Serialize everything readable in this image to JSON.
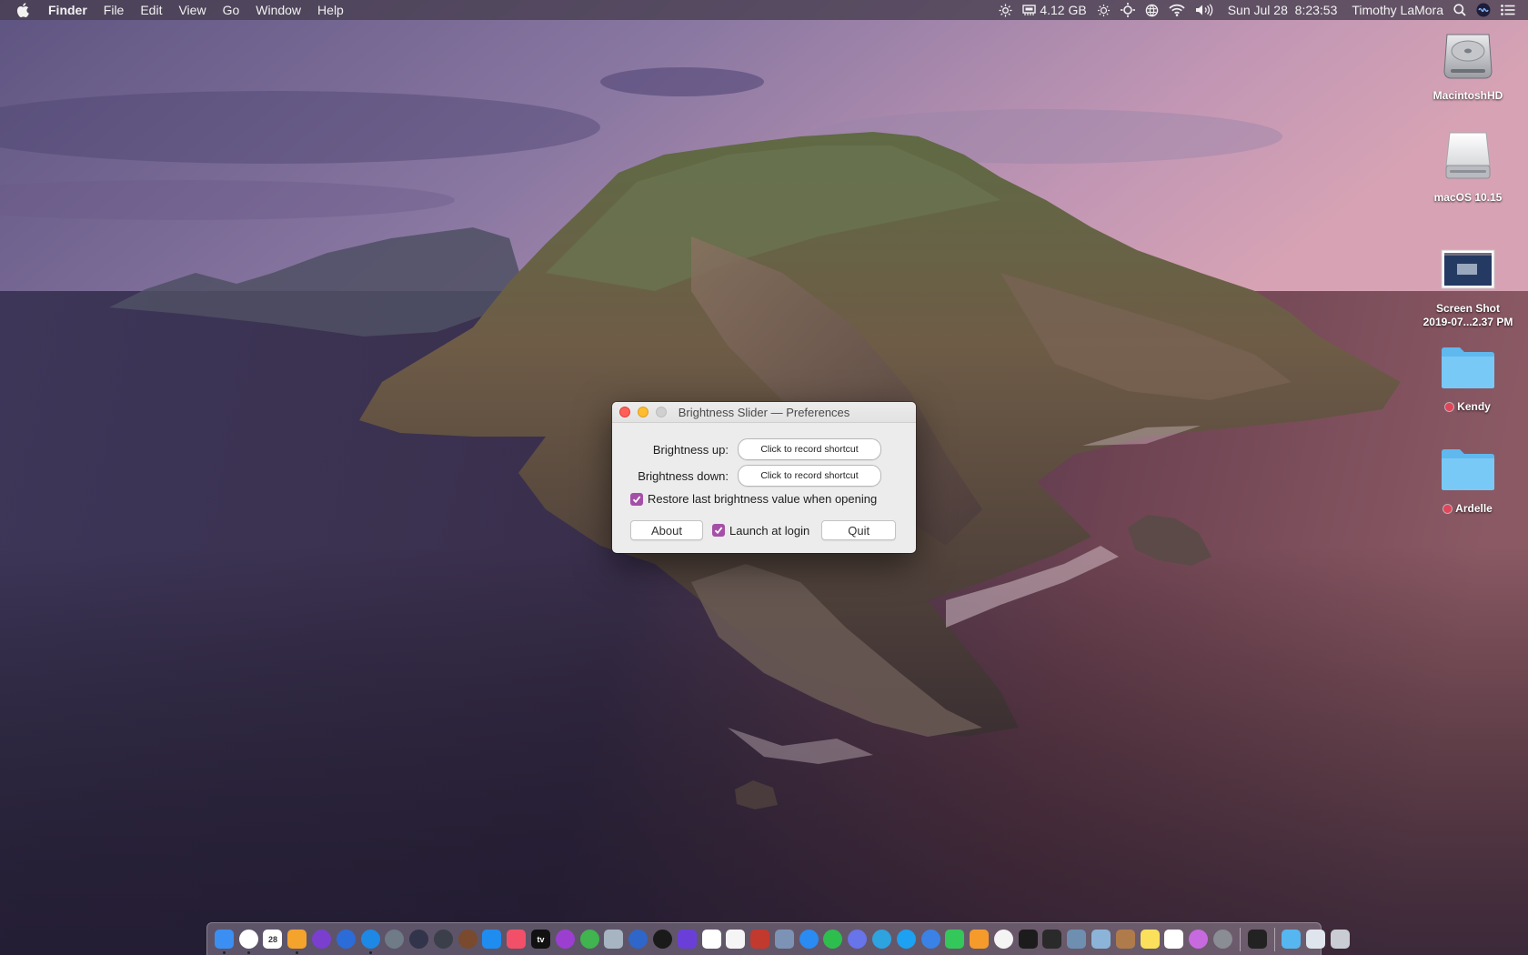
{
  "menubar": {
    "app_name": "Finder",
    "menus": [
      "File",
      "Edit",
      "View",
      "Go",
      "Window",
      "Help"
    ],
    "memory": "4.12 GB",
    "datetime": "Sun Jul 28  8:23:53",
    "user": "Timothy LaMora"
  },
  "desktop": {
    "icons": [
      {
        "label": "MacintoshHD",
        "kind": "hard-drive-icon"
      },
      {
        "label": "macOS 10.15",
        "kind": "external-drive-icon"
      },
      {
        "label": "Screen Shot\n2019-07...2.37 PM",
        "line1": "Screen Shot",
        "line2": "2019-07...2.37 PM",
        "kind": "screenshot-file-icon"
      },
      {
        "label": "Kendy",
        "kind": "folder-icon",
        "tag_color": "#e0455a"
      },
      {
        "label": "Ardelle",
        "kind": "folder-icon",
        "tag_color": "#e0455a"
      }
    ]
  },
  "prefs_window": {
    "title": "Brightness Slider — Preferences",
    "brightness_up_label": "Brightness up:",
    "brightness_down_label": "Brightness down:",
    "shortcut_placeholder": "Click to record shortcut",
    "restore_label": "Restore last brightness value when opening",
    "restore_checked": true,
    "about_label": "About",
    "launch_label": "Launch at login",
    "launch_checked": true,
    "quit_label": "Quit"
  },
  "dock": {
    "apps": [
      {
        "name": "finder-icon",
        "color": "#3b8ff2"
      },
      {
        "name": "launcher-icon",
        "color": "#ffffff"
      },
      {
        "name": "calendar-icon",
        "color": "#ffffff",
        "text": "28"
      },
      {
        "name": "flower-app-icon",
        "color": "#f4a32c"
      },
      {
        "name": "compass-app-icon",
        "color": "#7a3fcf"
      },
      {
        "name": "system-app-icon",
        "color": "#2c6cd8"
      },
      {
        "name": "safari-icon",
        "color": "#1e88e5"
      },
      {
        "name": "rocket-icon",
        "color": "#6f7b86"
      },
      {
        "name": "mac-os-icon",
        "color": "#31344a"
      },
      {
        "name": "camera-icon",
        "color": "#3a3f4a"
      },
      {
        "name": "planet-icon",
        "color": "#7a4a2e"
      },
      {
        "name": "app-store-icon",
        "color": "#1f8cf0"
      },
      {
        "name": "music-icon",
        "color": "#f25068"
      },
      {
        "name": "apple-tv-icon",
        "color": "#111111",
        "text": "tv"
      },
      {
        "name": "podcasts-icon",
        "color": "#9c3fd1"
      },
      {
        "name": "find-my-icon",
        "color": "#3fb44f"
      },
      {
        "name": "preview-icon",
        "color": "#a7b4c2"
      },
      {
        "name": "search-app-icon",
        "color": "#2f66c9"
      },
      {
        "name": "quicktime-icon",
        "color": "#1a1a1a"
      },
      {
        "name": "shortcuts-app-icon",
        "color": "#6a3fd8"
      },
      {
        "name": "youtube-icon",
        "color": "#ffffff"
      },
      {
        "name": "photos-icon",
        "color": "#f5f5f5"
      },
      {
        "name": "photo-booth-icon",
        "color": "#c2392e"
      },
      {
        "name": "image-capture-icon",
        "color": "#7d93b5"
      },
      {
        "name": "messenger-icon",
        "color": "#2a8bf2"
      },
      {
        "name": "whatsapp-icon",
        "color": "#2dbe4e"
      },
      {
        "name": "discord-icon",
        "color": "#6774ea"
      },
      {
        "name": "telegram-icon",
        "color": "#2da3e0"
      },
      {
        "name": "twitter-icon",
        "color": "#1da1f2"
      },
      {
        "name": "tweetbot-icon",
        "color": "#3a82e6"
      },
      {
        "name": "facetime-icon",
        "color": "#34c759"
      },
      {
        "name": "home-icon",
        "color": "#f59b2b"
      },
      {
        "name": "news-icon",
        "color": "#f4f4f4"
      },
      {
        "name": "stocks-icon",
        "color": "#1c1c1c"
      },
      {
        "name": "photo-editor-icon",
        "color": "#2a2a2a"
      },
      {
        "name": "sketch-app-icon",
        "color": "#6e8fb0"
      },
      {
        "name": "preview-doc-icon",
        "color": "#8cb4d9"
      },
      {
        "name": "contacts-icon",
        "color": "#b07b4a"
      },
      {
        "name": "notes-icon",
        "color": "#fbe15b"
      },
      {
        "name": "reminders-icon",
        "color": "#ffffff"
      },
      {
        "name": "bubble-app-icon",
        "color": "#c86adf"
      },
      {
        "name": "system-preferences-icon",
        "color": "#8a8d93"
      },
      {
        "name": "terminal-icon",
        "color": "#222222"
      },
      {
        "name": "downloads-folder-icon",
        "color": "#56b6f0"
      },
      {
        "name": "document-folder-icon",
        "color": "#dfe5ec"
      },
      {
        "name": "trash-icon",
        "color": "#c9cdd3"
      }
    ]
  }
}
